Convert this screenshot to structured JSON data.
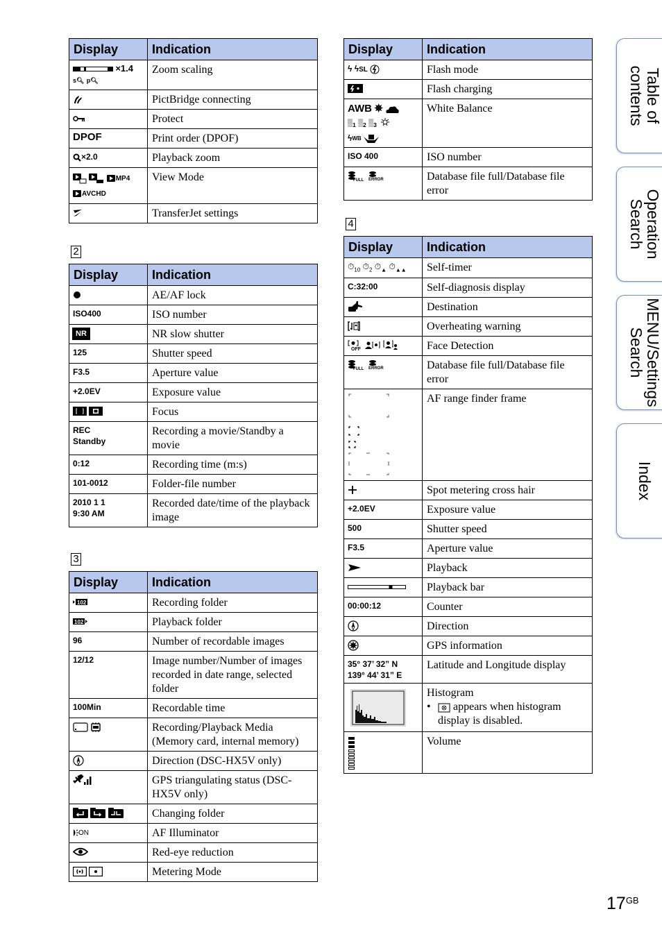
{
  "headers": {
    "display": "Display",
    "indication": "Indication"
  },
  "sections": {
    "s2": "2",
    "s3": "3",
    "s4": "4"
  },
  "table1": [
    {
      "display": "×1.4",
      "display_icons": [
        "zoom-scale-bar-icon",
        "smart-zoom-icon",
        "precision-zoom-icon"
      ],
      "indication": "Zoom scaling"
    },
    {
      "display_icons": [
        "pictbridge-icon"
      ],
      "indication": "PictBridge connecting"
    },
    {
      "display_icons": [
        "protect-key-icon"
      ],
      "indication": "Protect"
    },
    {
      "display": "DPOF",
      "indication": "Print order (DPOF)"
    },
    {
      "display": "×2.0",
      "display_icons": [
        "magnifier-icon"
      ],
      "indication": "Playback zoom"
    },
    {
      "display": "MP4 AVCHD",
      "display_icons": [
        "view-mode-date-icon",
        "view-mode-folder-icon",
        "view-mode-mp4-icon",
        "view-mode-avchd-icon"
      ],
      "indication": "View Mode"
    },
    {
      "display_icons": [
        "transferjet-icon"
      ],
      "indication": "TransferJet settings"
    }
  ],
  "table2": [
    {
      "display_icons": [
        "ae-af-lock-dot-icon"
      ],
      "indication": "AE/AF lock"
    },
    {
      "display": "ISO400",
      "indication": "ISO number"
    },
    {
      "display": "NR",
      "indication": "NR slow shutter"
    },
    {
      "display": "125",
      "indication": "Shutter speed"
    },
    {
      "display": "F3.5",
      "indication": "Aperture value"
    },
    {
      "display": "+2.0EV",
      "indication": "Exposure value"
    },
    {
      "display_icons": [
        "focus-bracket-icon",
        "focus-square-icon"
      ],
      "indication": "Focus"
    },
    {
      "display": "REC\nStandby",
      "indication": "Recording a movie/Standby a movie"
    },
    {
      "display": "0:12",
      "indication": "Recording time (m:s)"
    },
    {
      "display": "101-0012",
      "indication": "Folder-file number"
    },
    {
      "display": "2010 1 1\n9:30 AM",
      "indication": "Recorded date/time of the playback image"
    }
  ],
  "table3": [
    {
      "display_icons": [
        "recording-folder-icon"
      ],
      "indication": "Recording folder"
    },
    {
      "display_icons": [
        "playback-folder-icon"
      ],
      "indication": "Playback folder"
    },
    {
      "display": "96",
      "indication": "Number of recordable images"
    },
    {
      "display": "12/12",
      "indication": "Image number/Number of images recorded in date range, selected folder"
    },
    {
      "display": "100Min",
      "indication": "Recordable time"
    },
    {
      "display_icons": [
        "memory-card-icon",
        "internal-memory-icon"
      ],
      "indication": "Recording/Playback Media (Memory card, internal memory)"
    },
    {
      "display_icons": [
        "compass-direction-icon"
      ],
      "indication": "Direction (DSC-HX5V only)"
    },
    {
      "display_icons": [
        "gps-signal-icon"
      ],
      "indication": "GPS triangulating status (DSC-HX5V only)"
    },
    {
      "display_icons": [
        "folder-back-icon",
        "folder-forward-icon",
        "folder-both-icon"
      ],
      "indication": "Changing folder"
    },
    {
      "display": "ON",
      "display_icons": [
        "af-illuminator-icon"
      ],
      "indication": "AF Illuminator"
    },
    {
      "display_icons": [
        "eye-icon"
      ],
      "indication": "Red-eye reduction"
    },
    {
      "display_icons": [
        "multi-metering-icon",
        "spot-metering-icon"
      ],
      "indication": "Metering Mode"
    }
  ],
  "table_right1": [
    {
      "display": "SL",
      "display_icons": [
        "flash-icon",
        "slow-sync-icon",
        "flash-off-icon"
      ],
      "indication": "Flash mode"
    },
    {
      "display_icons": [
        "flash-charging-icon"
      ],
      "indication": "Flash charging"
    },
    {
      "display": "AWB",
      "display_icons": [
        "daylight-icon",
        "cloudy-icon",
        "fluorescent-1-icon",
        "fluorescent-2-icon",
        "fluorescent-3-icon",
        "incandescent-icon",
        "flash-wb-icon",
        "one-push-wb-icon"
      ],
      "indication": "White Balance"
    },
    {
      "display": "ISO 400",
      "indication": "ISO number"
    },
    {
      "display": "FULL ERROR",
      "display_icons": [
        "database-full-icon",
        "database-error-icon"
      ],
      "indication": "Database file full/Database file error"
    }
  ],
  "table4": [
    {
      "display": "10 2",
      "display_icons": [
        "self-timer-10-icon",
        "self-timer-2-icon",
        "self-portrait-one-icon",
        "self-portrait-two-icon"
      ],
      "indication": "Self-timer"
    },
    {
      "display": "C:32:00",
      "indication": "Self-diagnosis display"
    },
    {
      "display_icons": [
        "destination-plane-icon"
      ],
      "indication": "Destination"
    },
    {
      "display_icons": [
        "overheating-icon"
      ],
      "indication": "Overheating warning"
    },
    {
      "display": "OFF",
      "display_icons": [
        "face-detection-off-icon",
        "face-detection-child-icon",
        "face-detection-adult-icon"
      ],
      "indication": "Face Detection"
    },
    {
      "display": "FULL ERROR",
      "display_icons": [
        "database-full-icon",
        "database-error-icon"
      ],
      "indication": "Database file full/Database file error"
    },
    {
      "display_icons": [
        "af-frame-wide-icon",
        "af-frame-center-icon",
        "af-frame-small-icon",
        "af-frame-tall-icon"
      ],
      "indication": "AF range finder frame"
    },
    {
      "display_icons": [
        "crosshair-icon"
      ],
      "indication": "Spot metering cross hair"
    },
    {
      "display": "+2.0EV",
      "indication": "Exposure value"
    },
    {
      "display": "500",
      "indication": "Shutter speed"
    },
    {
      "display": "F3.5",
      "indication": "Aperture value"
    },
    {
      "display_icons": [
        "playback-triangle-icon"
      ],
      "indication": "Playback"
    },
    {
      "display_icons": [
        "playback-bar-icon"
      ],
      "playback_bar_position": 0.75,
      "indication": "Playback bar"
    },
    {
      "display": "00:00:12",
      "indication": "Counter"
    },
    {
      "display_icons": [
        "compass-direction-icon"
      ],
      "indication": "Direction"
    },
    {
      "display_icons": [
        "gps-info-icon"
      ],
      "indication": "GPS information"
    },
    {
      "display": "35° 37’ 32” N\n139° 44’ 31” E",
      "indication": "Latitude and Longitude display"
    },
    {
      "display_icons": [
        "histogram-icon"
      ],
      "indication": "Histogram",
      "note_prefix": "•",
      "note_icon": "histogram-disabled-icon",
      "note": "appears when histogram display is disabled."
    },
    {
      "display_icons": [
        "volume-bars-icon"
      ],
      "indication": "Volume"
    }
  ],
  "side_tabs": [
    {
      "label": "Table of\ncontents"
    },
    {
      "label": "Operation\nSearch"
    },
    {
      "label": "MENU/Settings\nSearch"
    },
    {
      "label": "Index"
    }
  ],
  "page": {
    "number": "17",
    "suffix": "GB"
  }
}
